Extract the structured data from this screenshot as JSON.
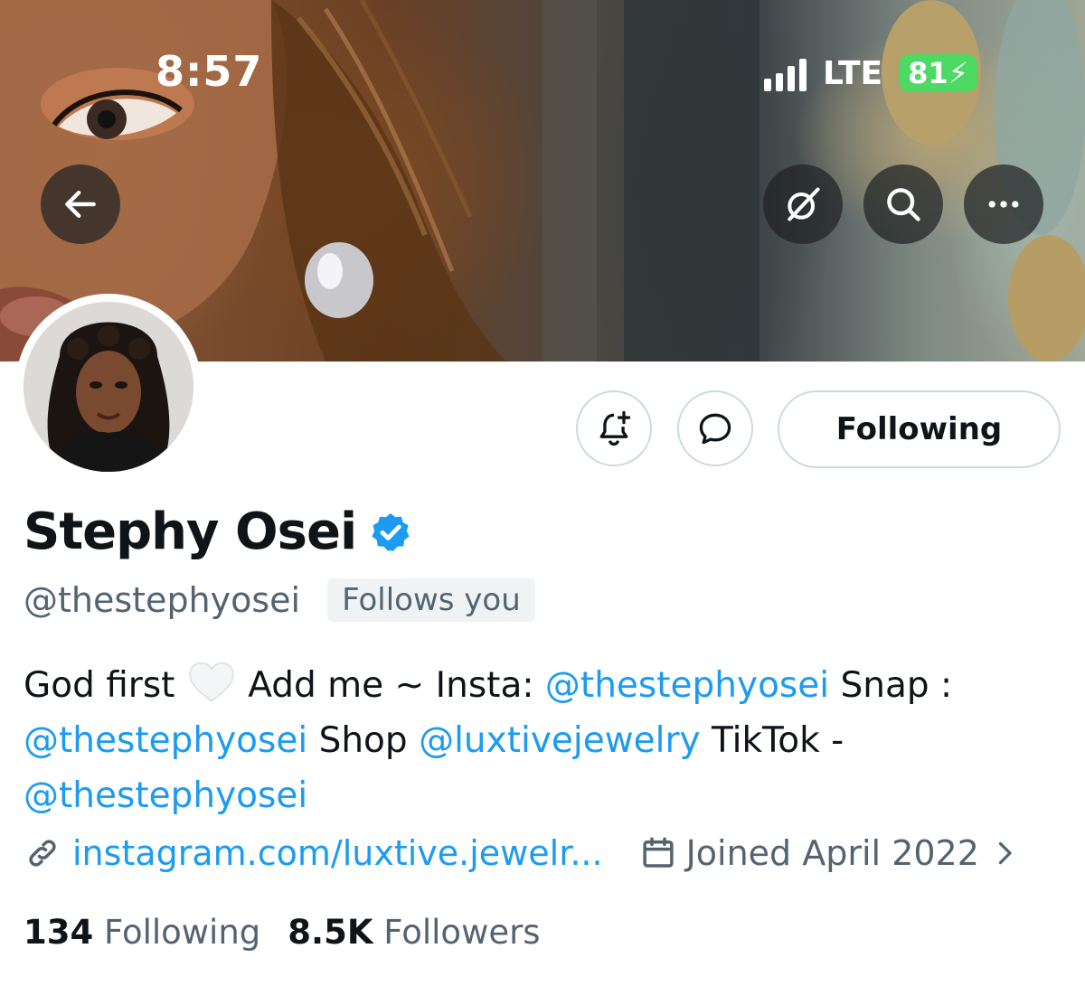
{
  "status_bar": {
    "time": "8:57",
    "network": "LTE",
    "battery": "81"
  },
  "banner": {
    "back_icon": "arrow-left-icon",
    "action_icons": [
      "grok-icon",
      "search-icon",
      "more-icon"
    ]
  },
  "actions": {
    "notify_icon": "bell-plus-icon",
    "message_icon": "message-icon",
    "following_label": "Following"
  },
  "profile": {
    "display_name": "Stephy Osei",
    "handle": "@thestephyosei",
    "follows_you": "Follows you",
    "bio": {
      "t1": "God first",
      "t2": "Add me ~ Insta:",
      "m1": "@thestephyosei",
      "t3": "Snap :",
      "m2": "@thestephyosei",
      "t4": "Shop",
      "m3": "@luxtivejewelry",
      "t5": "TikTok -",
      "m4": "@thestephyosei"
    },
    "website": "instagram.com/luxtive.jewelr...",
    "joined": "Joined April 2022",
    "following_count": "134",
    "following_label": "Following",
    "followers_count": "8.5K",
    "followers_label": "Followers"
  },
  "colors": {
    "accent": "#1d9bf0",
    "verified": "#1d9bf0",
    "secondary_text": "#536471",
    "battery": "#4cd964"
  }
}
